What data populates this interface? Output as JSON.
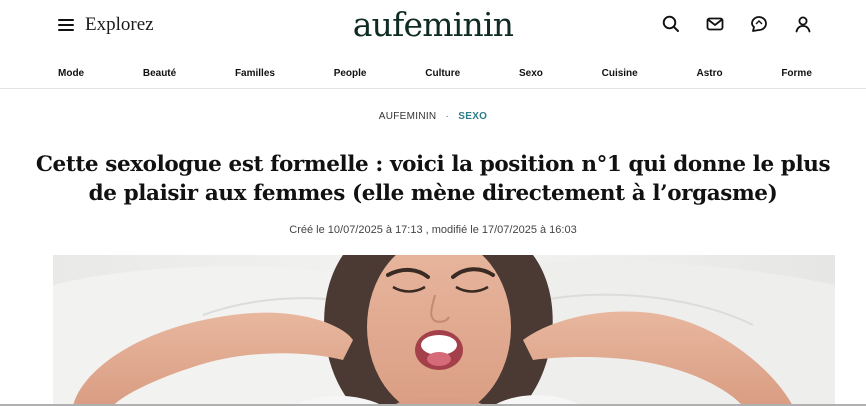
{
  "header": {
    "explore_label": "Explorez",
    "logo_text": "aufeminin",
    "icons": [
      "search-icon",
      "mail-icon",
      "chat-icon",
      "user-icon"
    ]
  },
  "nav": {
    "items": [
      "Mode",
      "Beauté",
      "Familles",
      "People",
      "Culture",
      "Sexo",
      "Cuisine",
      "Astro",
      "Forme"
    ]
  },
  "breadcrumb": {
    "home": "AUFEMININ",
    "separator": "·",
    "category": "SEXO"
  },
  "article": {
    "title_line1": "Cette sexologue est formelle : voici la position n°1 qui donne le plus",
    "title_line2": "de plaisir aux femmes (elle mène directement à l’orgasme)",
    "dates": "Créé le 10/07/2025 à 17:13 , modifié le 17/07/2025 à 16:03"
  },
  "colors": {
    "logo": "#0f2b24",
    "accent": "#2f7d8b",
    "text": "#111111",
    "divider": "#e3e3e3"
  }
}
